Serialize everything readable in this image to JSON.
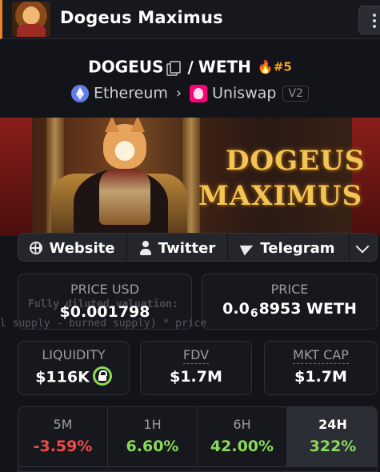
{
  "header": {
    "title": "Dogeus Maximus"
  },
  "pair": {
    "base": "DOGEUS",
    "separator": "/",
    "quote": "WETH",
    "rank": "#5",
    "chain": "Ethereum",
    "dex": "Uniswap",
    "version": "V2"
  },
  "banner": {
    "line1": "DOGEUS",
    "line2": "MAXIMUS"
  },
  "social": {
    "website": "Website",
    "twitter": "Twitter",
    "telegram": "Telegram"
  },
  "stats": {
    "price_usd_label": "PRICE USD",
    "price_usd": "$0.001798",
    "price_label": "PRICE",
    "price_prefix": "0.0",
    "price_zeros": "6",
    "price_rest": "8953 WETH",
    "liquidity_label": "LIQUIDITY",
    "liquidity": "$116K",
    "fdv_label": "FDV",
    "fdv": "$1.7M",
    "mktcap_label": "MKT CAP",
    "mktcap": "$1.7M"
  },
  "overlay": {
    "tooltip_title": "Fully diluted valuation:",
    "formula": "l supply - burned supply) * price"
  },
  "timeframes": [
    {
      "label": "5M",
      "value": "-3.59%"
    },
    {
      "label": "1H",
      "value": "6.60%"
    },
    {
      "label": "6H",
      "value": "42.00%"
    },
    {
      "label": "24H",
      "value": "322%"
    }
  ],
  "colors": {
    "accent": "#e8832b",
    "positive": "#8bd95a",
    "negative": "#f04a4a",
    "rank": "#f5a623"
  }
}
